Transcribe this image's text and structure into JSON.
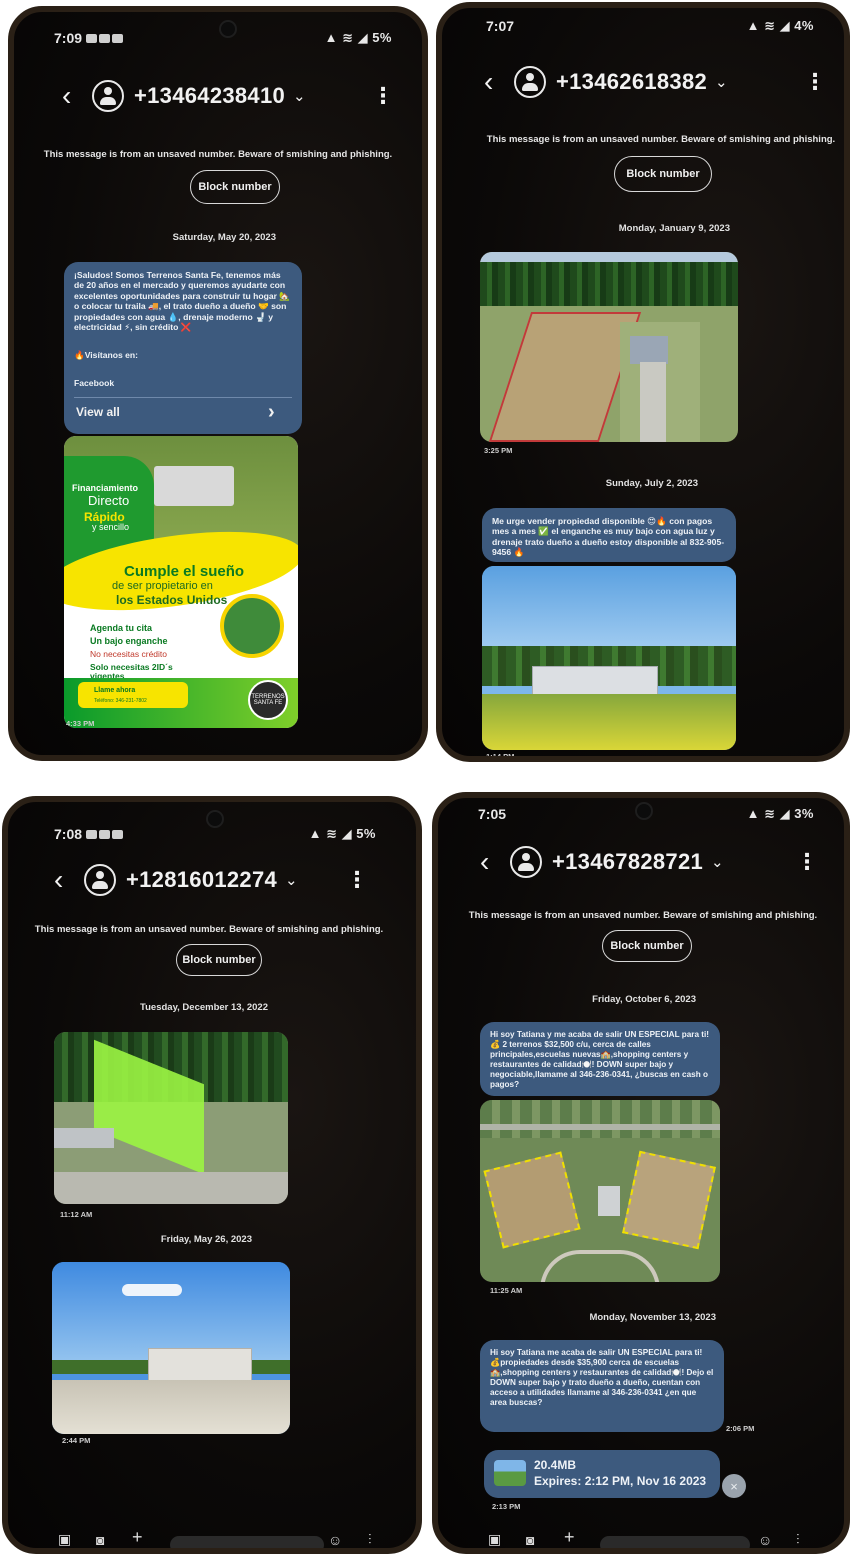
{
  "common": {
    "warning": "This message is from an unsaved number. Beware of smishing and phishing.",
    "block_label": "Block number",
    "back_glyph": "‹",
    "more_glyph": "⋮",
    "chevron_glyph": "⌄"
  },
  "phone1": {
    "status": {
      "time": "7:09",
      "right": "5%"
    },
    "contact": "+13464238410",
    "date": "Saturday, May 20, 2023",
    "message": {
      "text": "¡Saludos! Somos Terrenos Santa Fe, tenemos más de 20 años en el mercado y queremos ayudarte con excelentes oportunidades para construir tu hogar 🏡 o colocar tu traila 🚚, el trato dueño a dueño 🤝 son propiedades con agua 💧, drenaje moderno 🚽 y electricidad ⚡, sin crédito ❌",
      "visit": "🔥Visítanos en:",
      "link": "Facebook",
      "view_all": "View all",
      "view_all_arrow": "›"
    },
    "flyer": {
      "financ": "Financiamiento",
      "directo": "Directo",
      "rapido": "Rápido",
      "sencillo": "y sencillo",
      "headline": "Cumple el sueño",
      "sub": "de ser propietario en",
      "sub2": "los Estados Unidos",
      "items": [
        "Agenda tu cita",
        "Un bajo enganche",
        "No necesitas crédito",
        "Solo necesitas 2ID´s vigentes"
      ],
      "cta": "Llame ahora",
      "cta_phone": "Teléfono: 346-231-7802",
      "logo": "TERRENOS SANTA FE"
    },
    "timestamp": "4:33 PM"
  },
  "phone2": {
    "status": {
      "time": "7:07",
      "right": "4%"
    },
    "contact": "+13462618382",
    "date1": "Monday, January 9, 2023",
    "ts1": "3:25 PM",
    "date2": "Sunday, July 2, 2023",
    "message": "Me urge vender propiedad disponible 😍🔥 con pagos mes a mes ✅ el enganche es muy bajo con agua luz y drenaje trato dueño a dueño estoy disponible al 832-905-9456 🔥",
    "ts2": "1:14 PM"
  },
  "phone3": {
    "status": {
      "time": "7:08",
      "right": "5%"
    },
    "contact": "+12816012274",
    "date1": "Tuesday, December 13, 2022",
    "ts1": "11:12 AM",
    "date2": "Friday, May 26, 2023",
    "ts2": "2:44 PM"
  },
  "phone4": {
    "status": {
      "time": "7:05",
      "right": "3%"
    },
    "contact": "+13467828721",
    "date1": "Friday, October 6, 2023",
    "message1": "Hi soy Tatiana y me acaba de salir UN ESPECIAL para ti! 💰 2 terrenos $32,500 c/u, cerca de calles principales,escuelas nuevas🏫,shopping centers y restaurantes de calidad🍽️! DOWN super bajo y negociable,llamame al 346-236-0341, ¿buscas en cash o pagos?",
    "ts1": "11:25 AM",
    "date2": "Monday, November 13, 2023",
    "message2": "Hi soy Tatiana me acaba de salir UN ESPECIAL para ti! 💰propiedades desde $35,900 cerca de escuelas 🏫,shopping centers y restaurantes de calidad🍽️! Dejo el DOWN super bajo y trato dueño a dueño, cuentan con acceso a utilidades llamame al 346-236-0341 ¿en que area buscas?",
    "ts2": "2:06 PM",
    "attachment": {
      "size": "20.4MB",
      "expires": "Expires: 2:12 PM, Nov 16 2023"
    },
    "ts3": "2:13 PM",
    "close_glyph": "×"
  },
  "colors": {
    "bubble": "#3d5a7e",
    "screen": "#0b0908"
  }
}
